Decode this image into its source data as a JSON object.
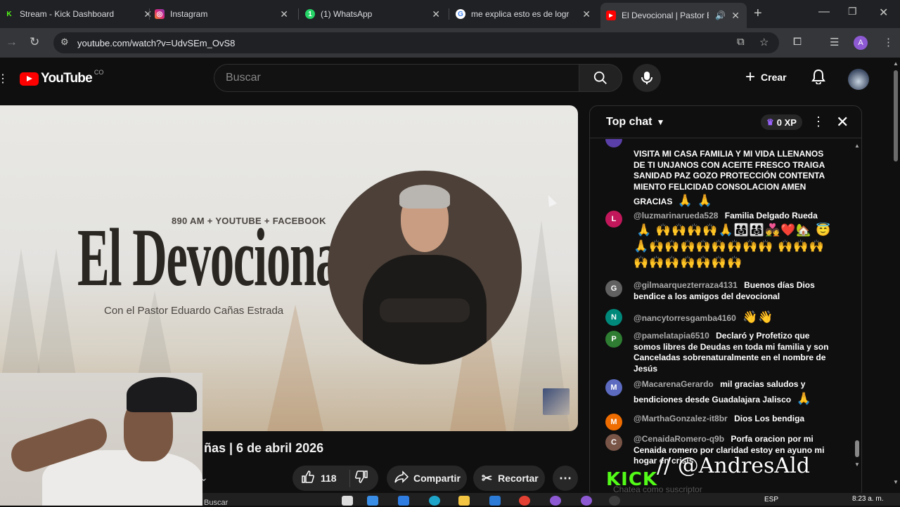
{
  "browser": {
    "tabs": [
      {
        "label": "Stream - Kick Dashboard",
        "favicon": "K",
        "color": "#53fc18"
      },
      {
        "label": "Instagram",
        "favicon": "◎",
        "color": "#e1306c"
      },
      {
        "label": "(1) WhatsApp",
        "favicon": "1",
        "color": "#25d366"
      },
      {
        "label": "me explica esto es de logro",
        "favicon": "G",
        "color": "#4285f4"
      },
      {
        "label": "El Devocional | Pastor Ed",
        "favicon": "▶",
        "color": "#ff0000"
      }
    ],
    "url": "youtube.com/watch?v=UdvSEm_OvS8",
    "profile_initial": "A"
  },
  "youtube": {
    "logo_text": "YouTube",
    "country_code": "CO",
    "search_placeholder": "Buscar",
    "create_label": "Crear"
  },
  "video": {
    "overlay_subtitle": "890 AM + YOUTUBE + FACEBOOK",
    "overlay_title": "El Devocional",
    "overlay_host": "Con el Pastor Eduardo Cañas Estrada",
    "title_visible": "ñas | 6 de abril 2026",
    "like_count": "118",
    "share_label": "Compartir",
    "clip_label": "Recortar"
  },
  "chat": {
    "mode_label": "Top chat",
    "xp_label": "0 XP",
    "messages": [
      {
        "initial": "",
        "author": "",
        "text": "VISITA MI CASA FAMILIA Y MI VIDA LLENANOS DE TI UNJANOS CON ACEITE FRESCO TRAIGA SANIDAD PAZ GOZO PROTECCIÓN CONTENTA MIENTO FELICIDAD CONSOLACION AMEN GRACIAS",
        "emoji": "🙏 🙏",
        "avatar_color": "#5b3fa8"
      },
      {
        "initial": "L",
        "author": "@luzmarinarueda528",
        "text": "Familia Delgado Rueda",
        "emoji": "🙏 🙌🙌🙌🙌🙏👨‍👩‍👧👨‍👩‍👧💑❤️🏡 😇🙏🙌🙌🙌🙌🙌🙌🙌🙌 🙌🙌🙌🙌🙌🙌🙌🙌🙌🙌",
        "avatar_color": "#c2185b"
      },
      {
        "initial": "G",
        "author": "@gilmaarquezterraza4131",
        "text": "Buenos días Dios bendice a los amigos del devocional",
        "emoji": "",
        "avatar_color": "#616161"
      },
      {
        "initial": "N",
        "author": "@nancytorresgamba4160",
        "text": "",
        "emoji": "👋👋",
        "avatar_color": "#00897b"
      },
      {
        "initial": "P",
        "author": "@pamelatapia6510",
        "text": "Declaró y Profetizo que somos libres de Deudas en toda mi familia y son Canceladas sobrenaturalmente en el nombre de Jesús",
        "emoji": "",
        "avatar_color": "#2e7d32"
      },
      {
        "initial": "M",
        "author": "@MacarenaGerardo",
        "text": "mil gracias saludos y bendiciones desde Guadalajara Jalisco",
        "emoji": "🙏",
        "avatar_color": "#5c6bc0"
      },
      {
        "initial": "M",
        "author": "@MarthaGonzalez-it8br",
        "text": "Dios Los bendiga",
        "emoji": "",
        "avatar_color": "#ef6c00"
      },
      {
        "initial": "C",
        "author": "@CenaidaRomero-q9b",
        "text": "Porfa oracion por mi Cenaida romero por claridad estoy en ayuno mi hogar en crisis",
        "emoji": "",
        "avatar_color": "#795548"
      }
    ],
    "input_placeholder": "Chatea como suscriptor"
  },
  "overlay": {
    "kick_logo": "KICK",
    "streamer_handle": "// @AndresAld"
  },
  "taskbar": {
    "search_label": "Buscar",
    "language": "ESP",
    "time": "8:23 a. m."
  }
}
